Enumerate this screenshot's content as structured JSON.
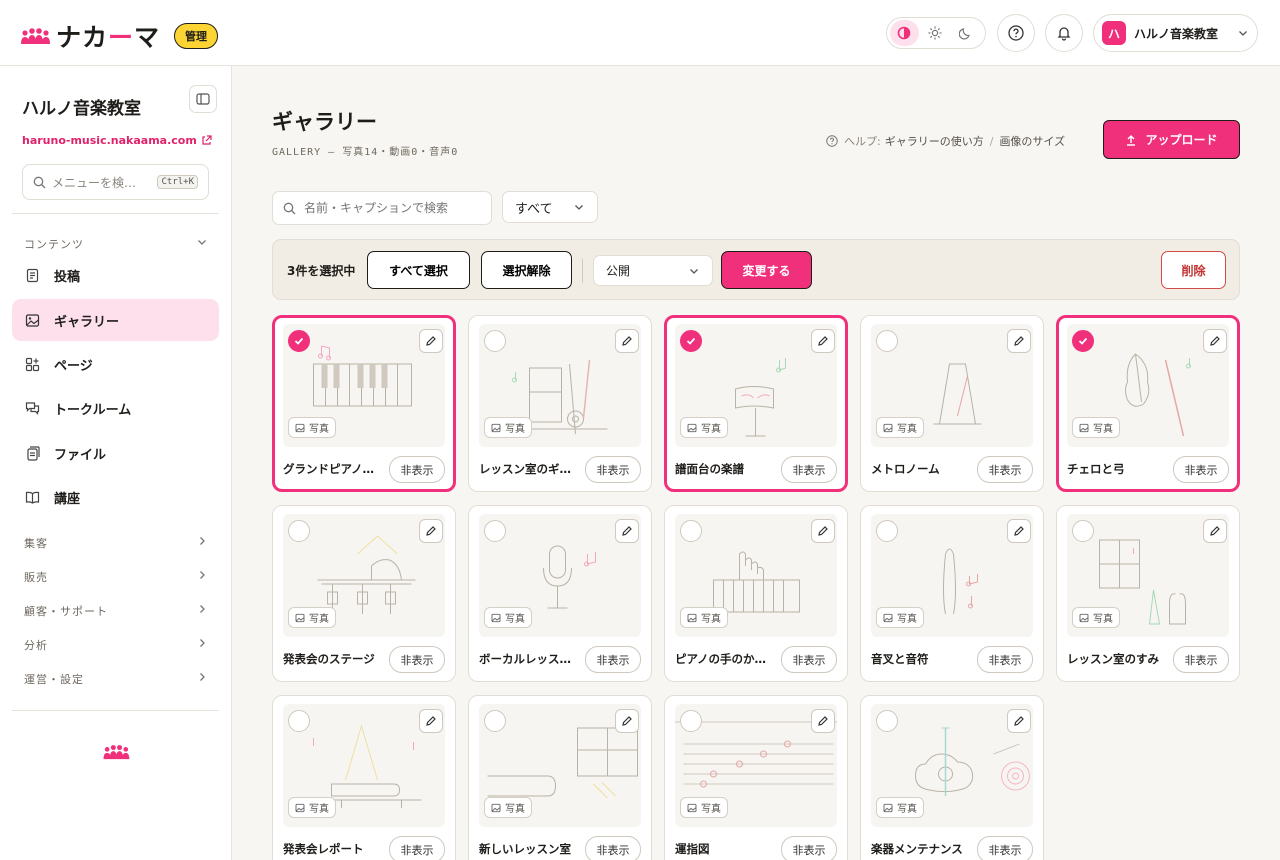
{
  "brand": {
    "name_a": "ナカ",
    "name_b": "ー",
    "name_c": "マ",
    "admin_badge": "管理",
    "accent": "#f0307b"
  },
  "topbar": {
    "account_initial": "ハ",
    "account_name": "ハルノ音楽教室"
  },
  "sidebar": {
    "title": "ハルノ音楽教室",
    "url": "haruno-music.nakaama.com",
    "search_placeholder": "メニューを検…",
    "shortcut": "Ctrl+K",
    "section_content": "コンテンツ",
    "items": [
      {
        "label": "投稿",
        "icon": "document-icon"
      },
      {
        "label": "ギャラリー",
        "icon": "image-icon"
      },
      {
        "label": "ページ",
        "icon": "pages-icon"
      },
      {
        "label": "トークルーム",
        "icon": "chat-icon"
      },
      {
        "label": "ファイル",
        "icon": "file-icon"
      },
      {
        "label": "講座",
        "icon": "book-icon"
      }
    ],
    "sections": [
      "集客",
      "販売",
      "顧客・サポート",
      "分析",
      "運営・設定"
    ]
  },
  "page": {
    "title": "ギャラリー",
    "subtitle": "GALLERY — 写真14・動画0・音声0",
    "help_label": "ヘルプ:",
    "help_link1": "ギャラリーの使い方",
    "help_sep": "/",
    "help_link2": "画像のサイズ",
    "upload_label": "アップロード"
  },
  "toolbar": {
    "search_placeholder": "名前・キャプションで検索",
    "filter_value": "すべて"
  },
  "bulk": {
    "count_label": "3件を選択中",
    "select_all": "すべて選択",
    "deselect": "選択解除",
    "visibility_value": "公開",
    "apply_label": "変更する",
    "delete_label": "削除"
  },
  "card_common": {
    "type_label": "写真",
    "hide_label": "非表示"
  },
  "cards": [
    {
      "caption": "グランドピアノ…",
      "selected": true,
      "art": "piano"
    },
    {
      "caption": "レッスン室のギ…",
      "selected": false,
      "art": "guitar"
    },
    {
      "caption": "譜面台の楽譜",
      "selected": true,
      "art": "stand"
    },
    {
      "caption": "メトロノーム",
      "selected": false,
      "art": "metronome"
    },
    {
      "caption": "チェロと弓",
      "selected": true,
      "art": "cello"
    },
    {
      "caption": "発表会のステージ",
      "selected": false,
      "art": "stage"
    },
    {
      "caption": "ボーカルレッス…",
      "selected": false,
      "art": "mic"
    },
    {
      "caption": "ピアノの手のか…",
      "selected": false,
      "art": "hand"
    },
    {
      "caption": "音叉と音符",
      "selected": false,
      "art": "fork"
    },
    {
      "caption": "レッスン室のすみ",
      "selected": false,
      "art": "corner"
    },
    {
      "caption": "発表会レポート",
      "selected": false,
      "art": "report"
    },
    {
      "caption": "新しいレッスン室",
      "selected": false,
      "art": "room"
    },
    {
      "caption": "運指図",
      "selected": false,
      "art": "fingering"
    },
    {
      "caption": "楽器メンテナンス",
      "selected": false,
      "art": "maintenance"
    }
  ]
}
